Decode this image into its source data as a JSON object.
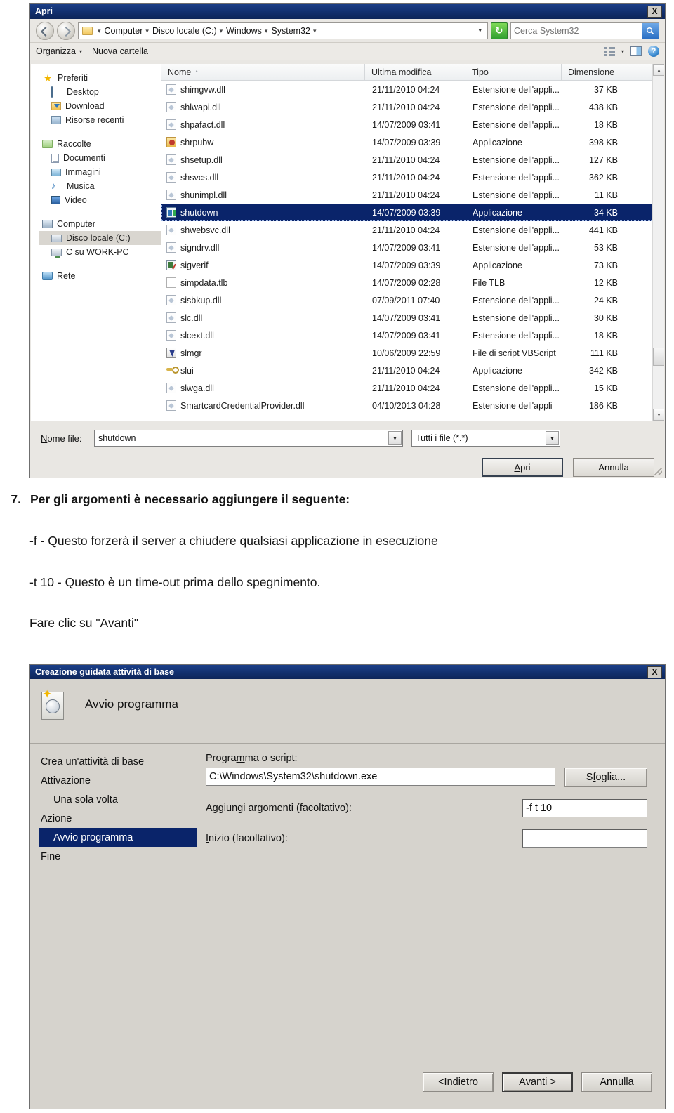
{
  "colors": {
    "titlebar_blue": "#12306e",
    "selection_blue": "#0a246a",
    "dialog_gray": "#d6d3cd",
    "accent_green": "#2f9e2f"
  },
  "open_dialog": {
    "title": "Apri",
    "close_label": "X",
    "breadcrumb": {
      "separator": "▾",
      "items": [
        "Computer",
        "Disco locale (C:)",
        "Windows",
        "System32"
      ],
      "trailing_caret": "▾",
      "dropdown_caret": "▾"
    },
    "refresh_label": "↻",
    "search": {
      "placeholder": "Cerca System32",
      "value": "",
      "icon": "search-icon"
    },
    "command_bar": {
      "organize_label": "Organizza",
      "organize_caret": "▾",
      "new_folder_label": "Nuova cartella",
      "view_caret": "▾",
      "help_label": "?"
    },
    "nav_pane": {
      "groups": [
        {
          "header": {
            "label": "Preferiti",
            "icon": "star-icon"
          },
          "items": [
            {
              "label": "Desktop",
              "icon": "desktop-icon"
            },
            {
              "label": "Download",
              "icon": "download-icon"
            },
            {
              "label": "Risorse recenti",
              "icon": "recent-places-icon"
            }
          ]
        },
        {
          "header": {
            "label": "Raccolte",
            "icon": "libraries-icon"
          },
          "items": [
            {
              "label": "Documenti",
              "icon": "documents-icon"
            },
            {
              "label": "Immagini",
              "icon": "pictures-icon"
            },
            {
              "label": "Musica",
              "icon": "music-icon"
            },
            {
              "label": "Video",
              "icon": "video-icon"
            }
          ]
        },
        {
          "header": {
            "label": "Computer",
            "icon": "computer-icon"
          },
          "items": [
            {
              "label": "Disco locale (C:)",
              "icon": "hard-drive-icon",
              "selected": true
            },
            {
              "label": "C su WORK-PC",
              "icon": "network-drive-icon"
            }
          ]
        },
        {
          "header": {
            "label": "Rete",
            "icon": "network-icon"
          },
          "items": []
        }
      ]
    },
    "columns": [
      {
        "label": "Nome",
        "sorted": "asc",
        "sort_glyph": "▴"
      },
      {
        "label": "Ultima modifica"
      },
      {
        "label": "Tipo"
      },
      {
        "label": "Dimensione"
      }
    ],
    "files": [
      {
        "name": "shimgvw.dll",
        "modified": "21/11/2010 04:24",
        "type": "Estensione dell'appli...",
        "size": "37 KB",
        "icon": "dll-icon"
      },
      {
        "name": "shlwapi.dll",
        "modified": "21/11/2010 04:24",
        "type": "Estensione dell'appli...",
        "size": "438 KB",
        "icon": "dll-icon"
      },
      {
        "name": "shpafact.dll",
        "modified": "14/07/2009 03:41",
        "type": "Estensione dell'appli...",
        "size": "18 KB",
        "icon": "dll-icon"
      },
      {
        "name": "shrpubw",
        "modified": "14/07/2009 03:39",
        "type": "Applicazione",
        "size": "398 KB",
        "icon": "share-wizard-icon"
      },
      {
        "name": "shsetup.dll",
        "modified": "21/11/2010 04:24",
        "type": "Estensione dell'appli...",
        "size": "127 KB",
        "icon": "dll-icon"
      },
      {
        "name": "shsvcs.dll",
        "modified": "21/11/2010 04:24",
        "type": "Estensione dell'appli...",
        "size": "362 KB",
        "icon": "dll-icon"
      },
      {
        "name": "shunimpl.dll",
        "modified": "21/11/2010 04:24",
        "type": "Estensione dell'appli...",
        "size": "11 KB",
        "icon": "dll-icon"
      },
      {
        "name": "shutdown",
        "modified": "14/07/2009 03:39",
        "type": "Applicazione",
        "size": "34 KB",
        "icon": "shutdown-exe-icon",
        "selected": true
      },
      {
        "name": "shwebsvc.dll",
        "modified": "21/11/2010 04:24",
        "type": "Estensione dell'appli...",
        "size": "441 KB",
        "icon": "dll-icon"
      },
      {
        "name": "signdrv.dll",
        "modified": "14/07/2009 03:41",
        "type": "Estensione dell'appli...",
        "size": "53 KB",
        "icon": "dll-icon"
      },
      {
        "name": "sigverif",
        "modified": "14/07/2009 03:39",
        "type": "Applicazione",
        "size": "73 KB",
        "icon": "sigverif-icon"
      },
      {
        "name": "simpdata.tlb",
        "modified": "14/07/2009 02:28",
        "type": "File TLB",
        "size": "12 KB",
        "icon": "tlb-file-icon"
      },
      {
        "name": "sisbkup.dll",
        "modified": "07/09/2011 07:40",
        "type": "Estensione dell'appli...",
        "size": "24 KB",
        "icon": "dll-icon"
      },
      {
        "name": "slc.dll",
        "modified": "14/07/2009 03:41",
        "type": "Estensione dell'appli...",
        "size": "30 KB",
        "icon": "dll-icon"
      },
      {
        "name": "slcext.dll",
        "modified": "14/07/2009 03:41",
        "type": "Estensione dell'appli...",
        "size": "18 KB",
        "icon": "dll-icon"
      },
      {
        "name": "slmgr",
        "modified": "10/06/2009 22:59",
        "type": "File di script VBScript",
        "size": "111 KB",
        "icon": "vbscript-icon"
      },
      {
        "name": "slui",
        "modified": "21/11/2010 04:24",
        "type": "Applicazione",
        "size": "342 KB",
        "icon": "key-icon"
      },
      {
        "name": "slwga.dll",
        "modified": "21/11/2010 04:24",
        "type": "Estensione dell'appli...",
        "size": "15 KB",
        "icon": "dll-icon"
      },
      {
        "name": "SmartcardCredentialProvider.dll",
        "modified": "04/10/2013 04:28",
        "type": "Estensione dell'appli",
        "size": "186 KB",
        "icon": "dll-icon"
      }
    ],
    "footer": {
      "filename_label_prefix": "N",
      "filename_label_rest": "ome file:",
      "filename_value": "shutdown",
      "filter_value": "Tutti i file (*.*)",
      "open_button": {
        "prefix": "A",
        "rest": "pri"
      },
      "cancel_button": "Annulla",
      "combo_caret": "▾"
    },
    "scrollbar": {
      "up": "▴",
      "down": "▾"
    }
  },
  "instructions": {
    "step_number": "7.",
    "step_text": "Per gli argomenti è necessario aggiungere il seguente:",
    "lines": [
      "-f - Questo forzerà il server a chiudere qualsiasi applicazione in esecuzione",
      "-t 10 - Questo è un time-out prima dello spegnimento.",
      "Fare clic su \"Avanti\""
    ]
  },
  "wizard": {
    "title": "Creazione guidata attività di base",
    "close_label": "X",
    "header_text": "Avvio programma",
    "header_icon": "task-clock-icon",
    "steps": [
      {
        "label": "Crea un'attività di base",
        "indent": false,
        "current": false
      },
      {
        "label": "Attivazione",
        "indent": false,
        "current": false
      },
      {
        "label": "Una sola volta",
        "indent": true,
        "current": false
      },
      {
        "label": "Azione",
        "indent": false,
        "current": false
      },
      {
        "label": "Avvio programma",
        "indent": true,
        "current": true
      },
      {
        "label": "Fine",
        "indent": false,
        "current": false
      }
    ],
    "form": {
      "program_label_pre": "Progra",
      "program_label_accel": "m",
      "program_label_post": "ma o script:",
      "program_value": "C:\\Windows\\System32\\shutdown.exe",
      "browse_button_pre": "S",
      "browse_button_accel": "f",
      "browse_button_post": "oglia...",
      "args_label_pre": "Aggi",
      "args_label_accel": "u",
      "args_label_post": "ngi argomenti (facoltativo):",
      "args_value": "-f t 10",
      "start_label_accel": "I",
      "start_label_post": "nizio (facoltativo):",
      "start_value": ""
    },
    "buttons": {
      "back_pre": "< ",
      "back_accel": "I",
      "back_post": "ndietro",
      "next_accel": "A",
      "next_post": "vanti >",
      "cancel": "Annulla"
    }
  }
}
